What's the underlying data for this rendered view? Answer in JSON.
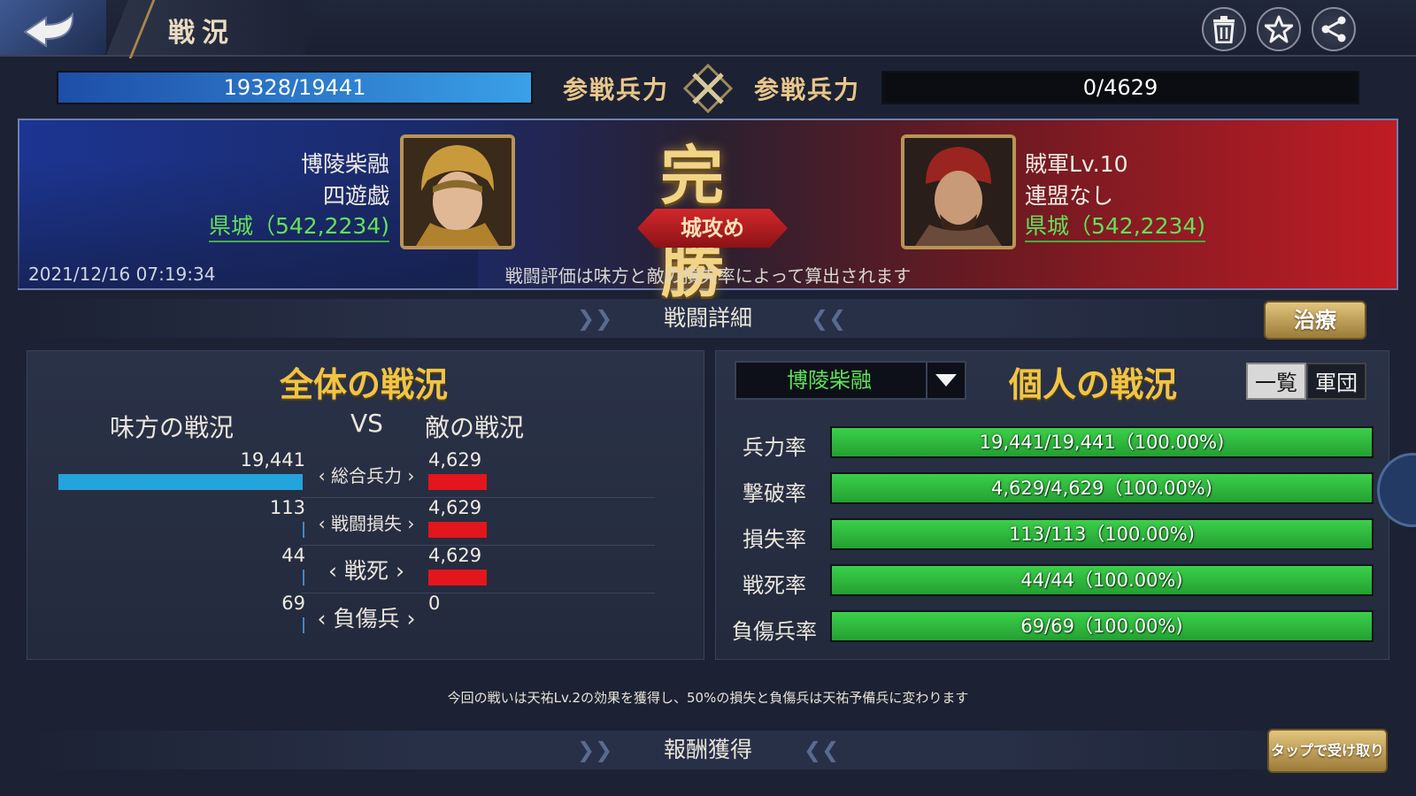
{
  "header": {
    "title": "戦況"
  },
  "toolbar": {
    "icons": [
      "trash-icon",
      "star-icon",
      "share-icon"
    ]
  },
  "troops": {
    "left_label": "参戦兵力",
    "right_label": "参戦兵力",
    "left_value": "19328/19441",
    "left_fill": 0.994,
    "right_value": "0/4629"
  },
  "battle": {
    "result": "完勝",
    "type": "城攻め",
    "timestamp": "2021/12/16  07:19:34",
    "note": "戦闘評価は味方と敵の損失率によって算出されます",
    "ally": {
      "name": "博陵柴融",
      "alliance": "四遊戯",
      "location": "県城（542,2234)"
    },
    "enemy": {
      "name": "賊軍Lv.10",
      "alliance": "連盟なし",
      "location": "県城（542,2234)"
    }
  },
  "details": {
    "section_title": "戦闘詳細",
    "heal_label": "治療"
  },
  "overall": {
    "title": "全体の戦況",
    "ally_head": "味方の戦況",
    "vs": "VS",
    "enemy_head": "敵の戦況",
    "rows": [
      {
        "label": "総合兵力",
        "ally": "19,441",
        "enemy": "4,629"
      },
      {
        "label": "戦闘損失",
        "ally": "113",
        "enemy": "4,629"
      },
      {
        "label": "戦死",
        "ally": "44",
        "enemy": "4,629"
      },
      {
        "label": "負傷兵",
        "ally": "69",
        "enemy": "0"
      }
    ]
  },
  "personal": {
    "title": "個人の戦況",
    "selected": "博陵柴融",
    "toggle_list": "一覧",
    "toggle_corps": "軍団",
    "rows": [
      {
        "label": "兵力率",
        "value": "19,441/19,441（100.00%)"
      },
      {
        "label": "撃破率",
        "value": "4,629/4,629（100.00%)"
      },
      {
        "label": "損失率",
        "value": "113/113（100.00%)"
      },
      {
        "label": "戦死率",
        "value": "44/44（100.00%)"
      },
      {
        "label": "負傷兵率",
        "value": "69/69（100.00%)"
      }
    ]
  },
  "footer_note": "今回の戦いは天祐Lv.2の効果を獲得し、50%の損失と負傷兵は天祐予備兵に変わります",
  "rewards": {
    "section_title": "報酬獲得",
    "claim_label": "タップで受け取り"
  },
  "colors": {
    "accent_gold": "#f0c445",
    "ally_blue": "#23a4dc",
    "enemy_red": "#e2161c",
    "rate_green": "#3bd04a"
  }
}
